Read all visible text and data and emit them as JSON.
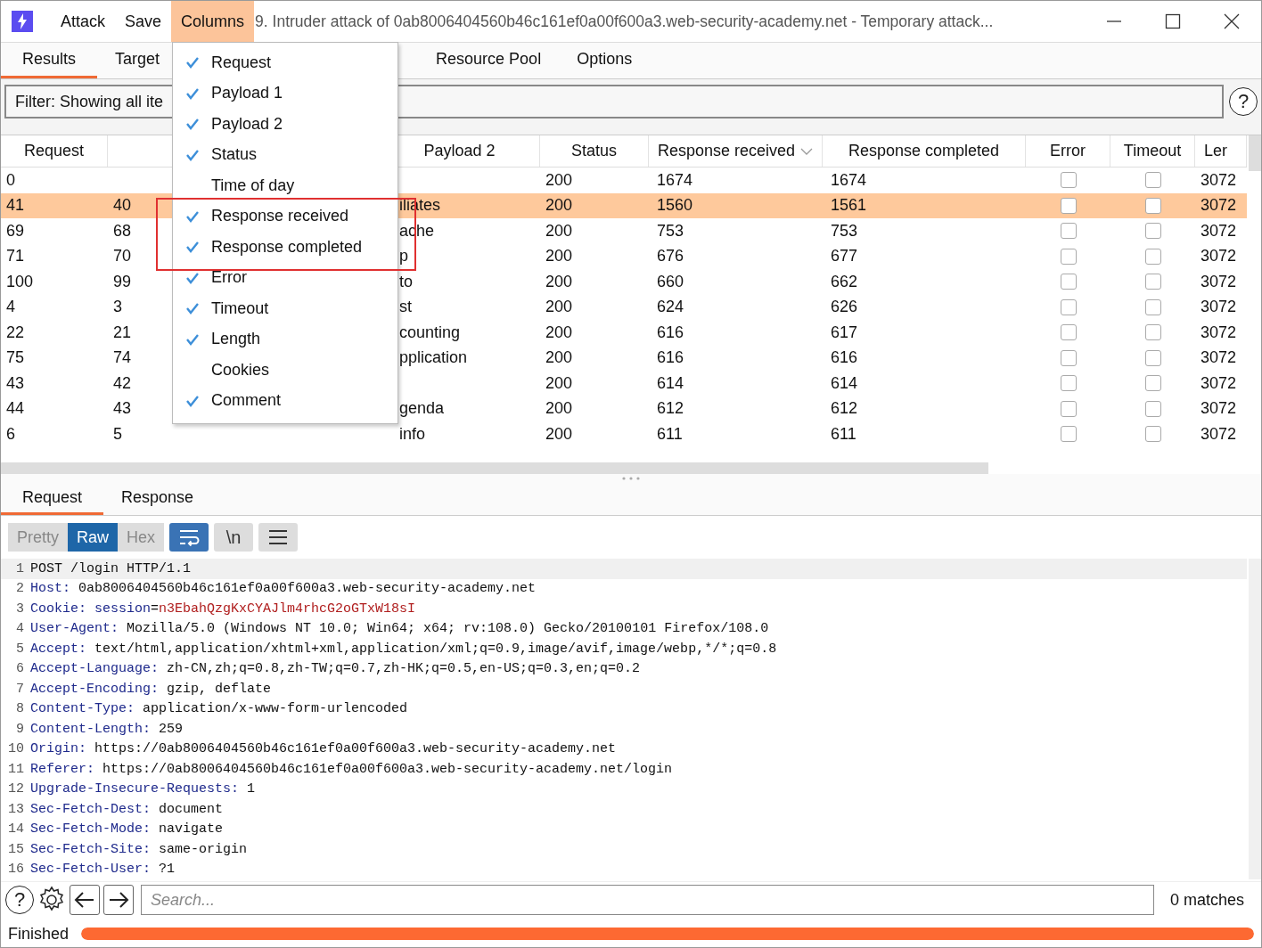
{
  "title_bar": {
    "menu": [
      {
        "label": "Attack",
        "selected": false
      },
      {
        "label": "Save",
        "selected": false
      },
      {
        "label": "Columns",
        "selected": true
      }
    ],
    "title": "9. Intruder attack of 0ab8006404560b46c161ef0a00f600a3.web-security-academy.net - Temporary attack..."
  },
  "tabs": [
    {
      "label": "Results",
      "selected": true
    },
    {
      "label": "Target",
      "selected": false
    },
    {
      "label": "Resource Pool",
      "selected": false
    },
    {
      "label": "Options",
      "selected": false
    }
  ],
  "filter": "Filter: Showing all ite",
  "filter_help": "?",
  "table": {
    "columns": [
      "Request",
      "",
      "Payload 2",
      "Status",
      "Response received",
      "Response completed",
      "Error",
      "Timeout",
      "Ler"
    ],
    "rows": [
      {
        "request": "0",
        "payload_1": "",
        "payload_2": "",
        "status": "200",
        "received": "1674",
        "completed": "1674",
        "error": false,
        "timeout": false,
        "length": "3072",
        "selected": false
      },
      {
        "request": "41",
        "payload_1": "40",
        "payload_2": "iliates",
        "status": "200",
        "received": "1560",
        "completed": "1561",
        "error": false,
        "timeout": false,
        "length": "3072",
        "selected": true
      },
      {
        "request": "69",
        "payload_1": "68",
        "payload_2": "ache",
        "status": "200",
        "received": "753",
        "completed": "753",
        "error": false,
        "timeout": false,
        "length": "3072",
        "selected": false
      },
      {
        "request": "71",
        "payload_1": "70",
        "payload_2": "p",
        "status": "200",
        "received": "676",
        "completed": "677",
        "error": false,
        "timeout": false,
        "length": "3072",
        "selected": false
      },
      {
        "request": "100",
        "payload_1": "99",
        "payload_2": "to",
        "status": "200",
        "received": "660",
        "completed": "662",
        "error": false,
        "timeout": false,
        "length": "3072",
        "selected": false
      },
      {
        "request": "4",
        "payload_1": "3",
        "payload_2": "st",
        "status": "200",
        "received": "624",
        "completed": "626",
        "error": false,
        "timeout": false,
        "length": "3072",
        "selected": false
      },
      {
        "request": "22",
        "payload_1": "21",
        "payload_2": "counting",
        "status": "200",
        "received": "616",
        "completed": "617",
        "error": false,
        "timeout": false,
        "length": "3072",
        "selected": false
      },
      {
        "request": "75",
        "payload_1": "74",
        "payload_2": "pplication",
        "status": "200",
        "received": "616",
        "completed": "616",
        "error": false,
        "timeout": false,
        "length": "3072",
        "selected": false
      },
      {
        "request": "43",
        "payload_1": "42",
        "payload_2": "",
        "status": "200",
        "received": "614",
        "completed": "614",
        "error": false,
        "timeout": false,
        "length": "3072",
        "selected": false
      },
      {
        "request": "44",
        "payload_1": "43",
        "payload_2": "genda",
        "status": "200",
        "received": "612",
        "completed": "612",
        "error": false,
        "timeout": false,
        "length": "3072",
        "selected": false
      },
      {
        "request": "6",
        "payload_1": "5",
        "payload_2": "info",
        "status": "200",
        "received": "611",
        "completed": "611",
        "error": false,
        "timeout": false,
        "length": "3072",
        "selected": false
      }
    ]
  },
  "columns_menu": [
    {
      "label": "Request",
      "checked": true
    },
    {
      "label": "Payload 1",
      "checked": true
    },
    {
      "label": "Payload 2",
      "checked": true
    },
    {
      "label": "Status",
      "checked": true
    },
    {
      "label": "Time of day",
      "checked": false
    },
    {
      "label": "Response received",
      "checked": true
    },
    {
      "label": "Response completed",
      "checked": true
    },
    {
      "label": "Error",
      "checked": true
    },
    {
      "label": "Timeout",
      "checked": true
    },
    {
      "label": "Length",
      "checked": true
    },
    {
      "label": "Cookies",
      "checked": false
    },
    {
      "label": "Comment",
      "checked": true
    }
  ],
  "detail_tabs": [
    {
      "label": "Request",
      "selected": true
    },
    {
      "label": "Response",
      "selected": false
    }
  ],
  "view_modes": [
    {
      "label": "Pretty",
      "selected": false
    },
    {
      "label": "Raw",
      "selected": true
    },
    {
      "label": "Hex",
      "selected": false
    }
  ],
  "toolbar": {
    "wrap_on": true,
    "newline_label": "\\n",
    "newline_on": false
  },
  "code_lines": [
    {
      "n": "1",
      "parts": [
        {
          "kind": "plain",
          "text": "POST /login HTTP/1.1"
        }
      ]
    },
    {
      "n": "2",
      "parts": [
        {
          "kind": "key",
          "text": "Host:"
        },
        {
          "kind": "plain",
          "text": " 0ab8006404560b46c161ef0a00f600a3.web-security-academy.net"
        }
      ]
    },
    {
      "n": "3",
      "parts": [
        {
          "kind": "key",
          "text": "Cookie:"
        },
        {
          "kind": "key",
          "text": " session"
        },
        {
          "kind": "plain",
          "text": "="
        },
        {
          "kind": "secret",
          "text": "n3EbahQzgKxCYAJlm4rhcG2oGTxW18sI"
        }
      ]
    },
    {
      "n": "4",
      "parts": [
        {
          "kind": "key",
          "text": "User-Agent:"
        },
        {
          "kind": "plain",
          "text": " Mozilla/5.0 (Windows NT 10.0; Win64; x64; rv:108.0) Gecko/20100101 Firefox/108.0"
        }
      ]
    },
    {
      "n": "5",
      "parts": [
        {
          "kind": "key",
          "text": "Accept:"
        },
        {
          "kind": "plain",
          "text": " text/html,application/xhtml+xml,application/xml;q=0.9,image/avif,image/webp,*/*;q=0.8"
        }
      ]
    },
    {
      "n": "6",
      "parts": [
        {
          "kind": "key",
          "text": "Accept-Language:"
        },
        {
          "kind": "plain",
          "text": " zh-CN,zh;q=0.8,zh-TW;q=0.7,zh-HK;q=0.5,en-US;q=0.3,en;q=0.2"
        }
      ]
    },
    {
      "n": "7",
      "parts": [
        {
          "kind": "key",
          "text": "Accept-Encoding:"
        },
        {
          "kind": "plain",
          "text": " gzip, deflate"
        }
      ]
    },
    {
      "n": "8",
      "parts": [
        {
          "kind": "key",
          "text": "Content-Type:"
        },
        {
          "kind": "plain",
          "text": " application/x-www-form-urlencoded"
        }
      ]
    },
    {
      "n": "9",
      "parts": [
        {
          "kind": "key",
          "text": "Content-Length:"
        },
        {
          "kind": "plain",
          "text": " 259"
        }
      ]
    },
    {
      "n": "10",
      "parts": [
        {
          "kind": "key",
          "text": "Origin:"
        },
        {
          "kind": "plain",
          "text": " https://0ab8006404560b46c161ef0a00f600a3.web-security-academy.net"
        }
      ]
    },
    {
      "n": "11",
      "parts": [
        {
          "kind": "key",
          "text": "Referer:"
        },
        {
          "kind": "plain",
          "text": " https://0ab8006404560b46c161ef0a00f600a3.web-security-academy.net/login"
        }
      ]
    },
    {
      "n": "12",
      "parts": [
        {
          "kind": "key",
          "text": "Upgrade-Insecure-Requests:"
        },
        {
          "kind": "plain",
          "text": " 1"
        }
      ]
    },
    {
      "n": "13",
      "parts": [
        {
          "kind": "key",
          "text": "Sec-Fetch-Dest:"
        },
        {
          "kind": "plain",
          "text": " document"
        }
      ]
    },
    {
      "n": "14",
      "parts": [
        {
          "kind": "key",
          "text": "Sec-Fetch-Mode:"
        },
        {
          "kind": "plain",
          "text": " navigate"
        }
      ]
    },
    {
      "n": "15",
      "parts": [
        {
          "kind": "key",
          "text": "Sec-Fetch-Site:"
        },
        {
          "kind": "plain",
          "text": " same-origin"
        }
      ]
    },
    {
      "n": "16",
      "parts": [
        {
          "kind": "key",
          "text": "Sec-Fetch-User:"
        },
        {
          "kind": "plain",
          "text": " ?1"
        }
      ]
    }
  ],
  "search": {
    "help": "?",
    "placeholder": "Search...",
    "matches": "0 matches"
  },
  "status": {
    "label": "Finished",
    "level": 1
  }
}
